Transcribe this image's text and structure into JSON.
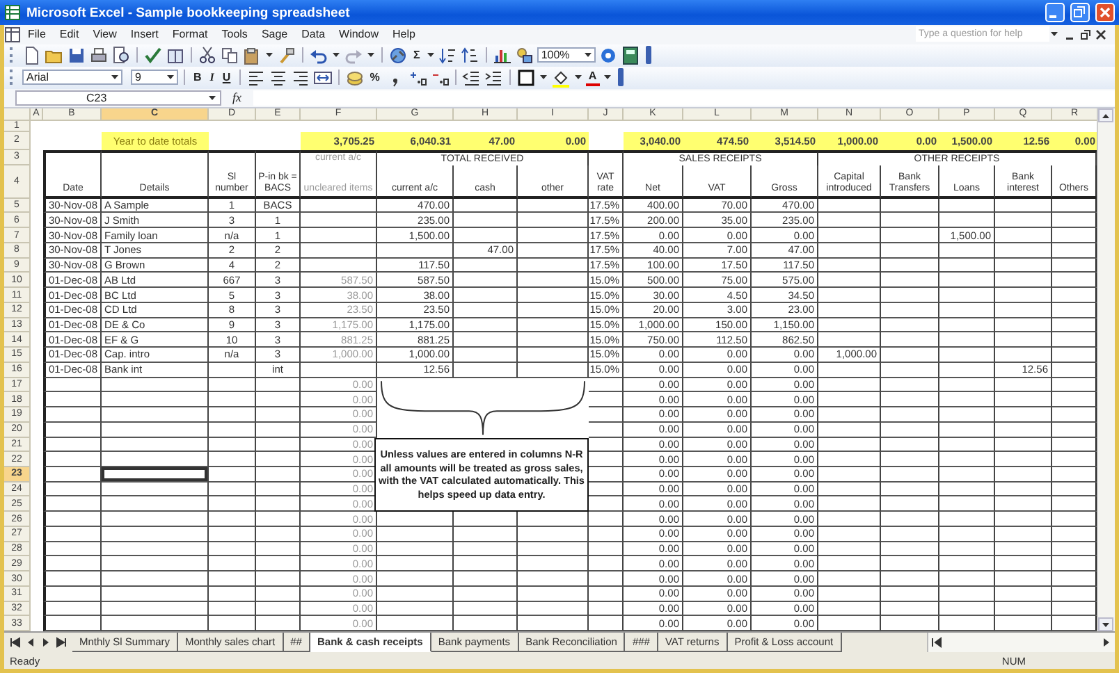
{
  "window": {
    "title": "Microsoft Excel - Sample bookkeeping spreadsheet"
  },
  "menu": [
    "File",
    "Edit",
    "View",
    "Insert",
    "Format",
    "Tools",
    "Sage",
    "Data",
    "Window",
    "Help"
  ],
  "help_box": {
    "placeholder": "Type a question for help"
  },
  "toolbar": {
    "sum": "Σ",
    "zoom": "100%",
    "font": "Arial",
    "size": "9",
    "bold": "B",
    "italic": "I",
    "underline": "U",
    "percent": "%",
    "font_color": "A"
  },
  "formula_bar": {
    "name_box": "C23",
    "function_label": "fx"
  },
  "sheet": {
    "columns": [
      {
        "letter": "A",
        "selected": false
      },
      {
        "letter": "B",
        "selected": false
      },
      {
        "letter": "C",
        "selected": true
      },
      {
        "letter": "D",
        "selected": false
      },
      {
        "letter": "E",
        "selected": false
      },
      {
        "letter": "F",
        "selected": false
      },
      {
        "letter": "G",
        "selected": false
      },
      {
        "letter": "H",
        "selected": false
      },
      {
        "letter": "I",
        "selected": false
      },
      {
        "letter": "J",
        "selected": false
      },
      {
        "letter": "K",
        "selected": false
      },
      {
        "letter": "L",
        "selected": false
      },
      {
        "letter": "M",
        "selected": false
      },
      {
        "letter": "N",
        "selected": false
      },
      {
        "letter": "O",
        "selected": false
      },
      {
        "letter": "P",
        "selected": false
      },
      {
        "letter": "Q",
        "selected": false
      },
      {
        "letter": "R",
        "selected": false
      }
    ],
    "groups": [
      {
        "title": "TOTAL RECEIVED"
      },
      {
        "title": "SALES RECEIPTS"
      },
      {
        "title": "OTHER RECEIPTS"
      }
    ],
    "rows": [
      {
        "number": "1",
        "kind": "blank",
        "selected": false,
        "cells": {}
      },
      {
        "number": "2",
        "kind": "totals",
        "selected": false,
        "cells": {
          "C": "Year to date totals",
          "F": "3,705.25",
          "G": "6,040.31",
          "H": "47.00",
          "I": "0.00",
          "K": "3,040.00",
          "L": "474.50",
          "M": "3,514.50",
          "N": "1,000.00",
          "O": "0.00",
          "P": "1,500.00",
          "Q": "12.56",
          "R": "0.00"
        }
      },
      {
        "number": "3",
        "kind": "group",
        "selected": false,
        "cells": {
          "F": "current a/c"
        }
      },
      {
        "number": "4",
        "kind": "header",
        "selected": false,
        "cells": {
          "B": "Date",
          "C": "Details",
          "D": "Sl number",
          "E": "P-in bk = BACS",
          "F": "uncleared items",
          "G": "current a/c",
          "H": "cash",
          "I": "other",
          "J": "VAT rate",
          "K": "Net",
          "L": "VAT",
          "M": "Gross",
          "N": "Capital introduced",
          "O": "Bank Transfers",
          "P": "Loans",
          "Q": "Bank interest",
          "R": "Others"
        }
      },
      {
        "number": "5",
        "kind": "data",
        "selected": false,
        "cells": {
          "B": "30-Nov-08",
          "C": "A Sample",
          "D": "1",
          "E": "BACS",
          "G": "470.00",
          "J": "17.5%",
          "K": "400.00",
          "L": "70.00",
          "M": "470.00"
        }
      },
      {
        "number": "6",
        "kind": "data",
        "selected": false,
        "cells": {
          "B": "30-Nov-08",
          "C": "J Smith",
          "D": "3",
          "E": "1",
          "G": "235.00",
          "J": "17.5%",
          "K": "200.00",
          "L": "35.00",
          "M": "235.00"
        }
      },
      {
        "number": "7",
        "kind": "data",
        "selected": false,
        "cells": {
          "B": "30-Nov-08",
          "C": "Family loan",
          "D": "n/a",
          "E": "1",
          "G": "1,500.00",
          "J": "17.5%",
          "K": "0.00",
          "L": "0.00",
          "M": "0.00",
          "P": "1,500.00"
        }
      },
      {
        "number": "8",
        "kind": "data",
        "selected": false,
        "cells": {
          "B": "30-Nov-08",
          "C": "T Jones",
          "D": "2",
          "E": "2",
          "H": "47.00",
          "J": "17.5%",
          "K": "40.00",
          "L": "7.00",
          "M": "47.00"
        }
      },
      {
        "number": "9",
        "kind": "data",
        "selected": false,
        "cells": {
          "B": "30-Nov-08",
          "C": "G Brown",
          "D": "4",
          "E": "2",
          "G": "117.50",
          "J": "17.5%",
          "K": "100.00",
          "L": "17.50",
          "M": "117.50"
        }
      },
      {
        "number": "10",
        "kind": "data",
        "selected": false,
        "cells": {
          "B": "01-Dec-08",
          "C": "AB Ltd",
          "D": "667",
          "E": "3",
          "F": "587.50",
          "G": "587.50",
          "J": "15.0%",
          "K": "500.00",
          "L": "75.00",
          "M": "575.00"
        }
      },
      {
        "number": "11",
        "kind": "data",
        "selected": false,
        "cells": {
          "B": "01-Dec-08",
          "C": "BC Ltd",
          "D": "5",
          "E": "3",
          "F": "38.00",
          "G": "38.00",
          "J": "15.0%",
          "K": "30.00",
          "L": "4.50",
          "M": "34.50"
        }
      },
      {
        "number": "12",
        "kind": "data",
        "selected": false,
        "cells": {
          "B": "01-Dec-08",
          "C": "CD Ltd",
          "D": "8",
          "E": "3",
          "F": "23.50",
          "G": "23.50",
          "J": "15.0%",
          "K": "20.00",
          "L": "3.00",
          "M": "23.00"
        }
      },
      {
        "number": "13",
        "kind": "data",
        "selected": false,
        "cells": {
          "B": "01-Dec-08",
          "C": "DE & Co",
          "D": "9",
          "E": "3",
          "F": "1,175.00",
          "G": "1,175.00",
          "J": "15.0%",
          "K": "1,000.00",
          "L": "150.00",
          "M": "1,150.00"
        }
      },
      {
        "number": "14",
        "kind": "data",
        "selected": false,
        "cells": {
          "B": "01-Dec-08",
          "C": "EF & G",
          "D": "10",
          "E": "3",
          "F": "881.25",
          "G": "881.25",
          "J": "15.0%",
          "K": "750.00",
          "L": "112.50",
          "M": "862.50"
        }
      },
      {
        "number": "15",
        "kind": "data",
        "selected": false,
        "cells": {
          "B": "01-Dec-08",
          "C": "Cap. intro",
          "D": "n/a",
          "E": "3",
          "F": "1,000.00",
          "G": "1,000.00",
          "J": "15.0%",
          "K": "0.00",
          "L": "0.00",
          "M": "0.00",
          "N": "1,000.00"
        }
      },
      {
        "number": "16",
        "kind": "data",
        "selected": false,
        "cells": {
          "B": "01-Dec-08",
          "C": "Bank int",
          "E": "int",
          "G": "12.56",
          "J": "15.0%",
          "K": "0.00",
          "L": "0.00",
          "M": "0.00",
          "Q": "12.56"
        }
      },
      {
        "number": "17",
        "kind": "data",
        "selected": false,
        "cells": {
          "F": "0.00",
          "K": "0.00",
          "L": "0.00",
          "M": "0.00"
        }
      },
      {
        "number": "18",
        "kind": "data",
        "selected": false,
        "cells": {
          "F": "0.00",
          "K": "0.00",
          "L": "0.00",
          "M": "0.00"
        }
      },
      {
        "number": "19",
        "kind": "data",
        "selected": false,
        "cells": {
          "F": "0.00",
          "K": "0.00",
          "L": "0.00",
          "M": "0.00"
        }
      },
      {
        "number": "20",
        "kind": "data",
        "selected": false,
        "cells": {
          "F": "0.00",
          "K": "0.00",
          "L": "0.00",
          "M": "0.00"
        }
      },
      {
        "number": "21",
        "kind": "data",
        "selected": false,
        "cells": {
          "F": "0.00",
          "K": "0.00",
          "L": "0.00",
          "M": "0.00"
        }
      },
      {
        "number": "22",
        "kind": "data",
        "selected": false,
        "cells": {
          "F": "0.00",
          "K": "0.00",
          "L": "0.00",
          "M": "0.00"
        }
      },
      {
        "number": "23",
        "kind": "data",
        "selected": true,
        "cells": {
          "F": "0.00",
          "K": "0.00",
          "L": "0.00",
          "M": "0.00"
        }
      },
      {
        "number": "24",
        "kind": "data",
        "selected": false,
        "cells": {
          "F": "0.00",
          "K": "0.00",
          "L": "0.00",
          "M": "0.00"
        }
      },
      {
        "number": "25",
        "kind": "data",
        "selected": false,
        "cells": {
          "F": "0.00",
          "K": "0.00",
          "L": "0.00",
          "M": "0.00"
        }
      },
      {
        "number": "26",
        "kind": "data",
        "selected": false,
        "cells": {
          "F": "0.00",
          "K": "0.00",
          "L": "0.00",
          "M": "0.00"
        }
      },
      {
        "number": "27",
        "kind": "data",
        "selected": false,
        "cells": {
          "F": "0.00",
          "K": "0.00",
          "L": "0.00",
          "M": "0.00"
        }
      },
      {
        "number": "28",
        "kind": "data",
        "selected": false,
        "cells": {
          "F": "0.00",
          "K": "0.00",
          "L": "0.00",
          "M": "0.00"
        }
      },
      {
        "number": "29",
        "kind": "data",
        "selected": false,
        "cells": {
          "F": "0.00",
          "K": "0.00",
          "L": "0.00",
          "M": "0.00"
        }
      },
      {
        "number": "30",
        "kind": "data",
        "selected": false,
        "cells": {
          "F": "0.00",
          "K": "0.00",
          "L": "0.00",
          "M": "0.00"
        }
      },
      {
        "number": "31",
        "kind": "data",
        "selected": false,
        "cells": {
          "F": "0.00",
          "K": "0.00",
          "L": "0.00",
          "M": "0.00"
        }
      },
      {
        "number": "32",
        "kind": "data",
        "selected": false,
        "cells": {
          "F": "0.00",
          "K": "0.00",
          "L": "0.00",
          "M": "0.00"
        }
      },
      {
        "number": "33",
        "kind": "data",
        "selected": false,
        "cells": {
          "F": "0.00",
          "K": "0.00",
          "L": "0.00",
          "M": "0.00"
        }
      }
    ],
    "note": "Unless values are entered in columns N-R all amounts will be treated as gross sales, with the VAT calculated automatically. This helps speed up data entry."
  },
  "sheet_tabs": [
    {
      "label": "Mnthly Sl Summary",
      "selected": false
    },
    {
      "label": "Monthly sales chart",
      "selected": false
    },
    {
      "label": "##",
      "selected": false
    },
    {
      "label": "Bank & cash receipts",
      "selected": true
    },
    {
      "label": "Bank payments",
      "selected": false
    },
    {
      "label": "Bank Reconciliation",
      "selected": false
    },
    {
      "label": "###",
      "selected": false
    },
    {
      "label": "VAT returns",
      "selected": false
    },
    {
      "label": "Profit & Loss account",
      "selected": false
    }
  ],
  "status_bar": {
    "left": "Ready",
    "right": "NUM"
  }
}
